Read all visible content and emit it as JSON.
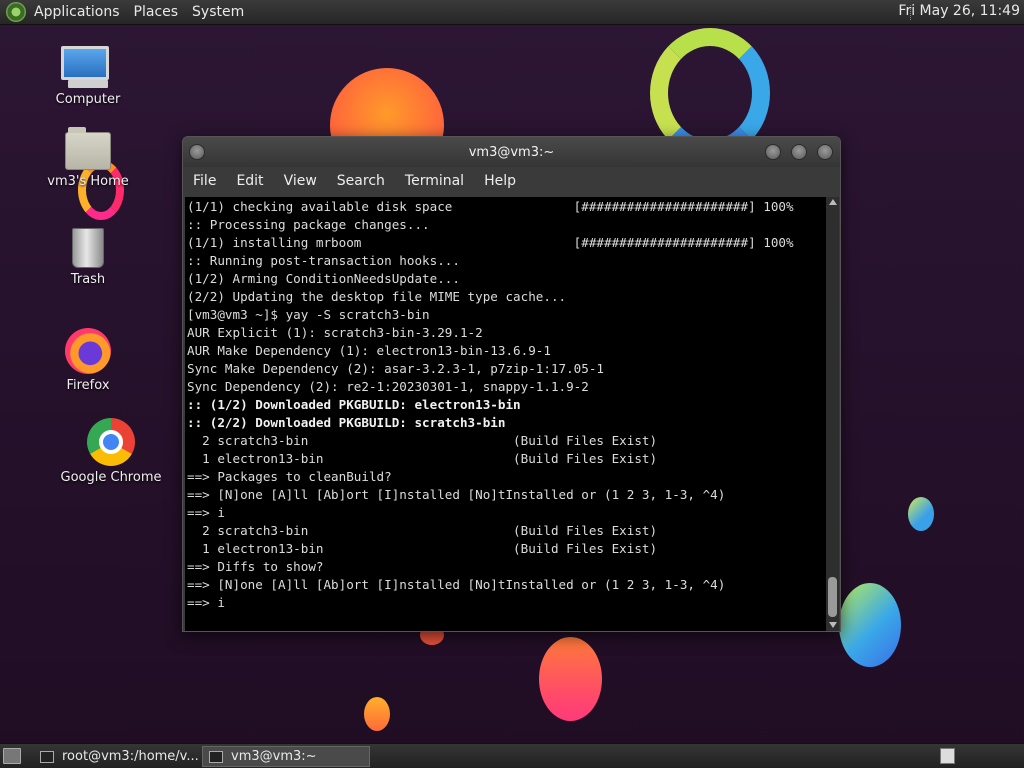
{
  "top_panel": {
    "menus": [
      "Applications",
      "Places",
      "System"
    ],
    "clock": "Fri May 26, 11:49"
  },
  "desktop_icons": {
    "computer": "Computer",
    "home": "vm3's Home",
    "trash": "Trash",
    "firefox": "Firefox",
    "chrome": "Google Chrome"
  },
  "terminal": {
    "title": "vm3@vm3:~",
    "menu": [
      "File",
      "Edit",
      "View",
      "Search",
      "Terminal",
      "Help"
    ],
    "lines": [
      {
        "text": "(1/1) checking available disk space                [######################] 100%",
        "bold": false
      },
      {
        "text": ":: Processing package changes...",
        "bold": false
      },
      {
        "text": "(1/1) installing mrboom                            [######################] 100%",
        "bold": false
      },
      {
        "text": ":: Running post-transaction hooks...",
        "bold": false
      },
      {
        "text": "(1/2) Arming ConditionNeedsUpdate...",
        "bold": false
      },
      {
        "text": "(2/2) Updating the desktop file MIME type cache...",
        "bold": false
      },
      {
        "text": "[vm3@vm3 ~]$ yay -S scratch3-bin",
        "bold": false
      },
      {
        "text": "AUR Explicit (1): scratch3-bin-3.29.1-2",
        "bold": false
      },
      {
        "text": "AUR Make Dependency (1): electron13-bin-13.6.9-1",
        "bold": false
      },
      {
        "text": "Sync Make Dependency (2): asar-3.2.3-1, p7zip-1:17.05-1",
        "bold": false
      },
      {
        "text": "Sync Dependency (2): re2-1:20230301-1, snappy-1.1.9-2",
        "bold": false
      },
      {
        "text": ":: (1/2) Downloaded PKGBUILD: electron13-bin",
        "bold": true
      },
      {
        "text": ":: (2/2) Downloaded PKGBUILD: scratch3-bin",
        "bold": true
      },
      {
        "text": "  2 scratch3-bin                           (Build Files Exist)",
        "bold": false
      },
      {
        "text": "  1 electron13-bin                         (Build Files Exist)",
        "bold": false
      },
      {
        "text": "==> Packages to cleanBuild?",
        "bold": false
      },
      {
        "text": "==> [N]one [A]ll [Ab]ort [I]nstalled [No]tInstalled or (1 2 3, 1-3, ^4)",
        "bold": false
      },
      {
        "text": "==> i",
        "bold": false
      },
      {
        "text": "  2 scratch3-bin                           (Build Files Exist)",
        "bold": false
      },
      {
        "text": "  1 electron13-bin                         (Build Files Exist)",
        "bold": false
      },
      {
        "text": "==> Diffs to show?",
        "bold": false
      },
      {
        "text": "==> [N]one [A]ll [Ab]ort [I]nstalled [No]tInstalled or (1 2 3, 1-3, ^4)",
        "bold": false
      },
      {
        "text": "==> i",
        "bold": false
      }
    ]
  },
  "taskbar": {
    "tasks": [
      "root@vm3:/home/v...",
      "vm3@vm3:~"
    ]
  }
}
